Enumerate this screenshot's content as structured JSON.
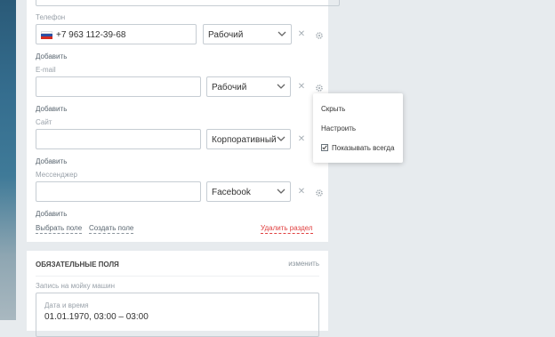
{
  "phone": {
    "label": "Телефон",
    "value": "+7 963 112-39-68",
    "type": "Рабочий",
    "add": "Добавить"
  },
  "email": {
    "label": "E-mail",
    "value": "",
    "type": "Рабочий",
    "add": "Добавить"
  },
  "site": {
    "label": "Сайт",
    "value": "",
    "type": "Корпоративный",
    "add": "Добавить"
  },
  "messenger": {
    "label": "Мессенджер",
    "value": "",
    "type": "Facebook",
    "add": "Добавить"
  },
  "footer_links": {
    "choose_field": "Выбрать поле",
    "create_field": "Создать поле",
    "delete_section": "Удалить раздел"
  },
  "popup": {
    "hide": "Скрыть",
    "configure": "Настроить",
    "show_always": "Показывать всегда",
    "show_always_checked": true
  },
  "required_section": {
    "title": "ОБЯЗАТЕЛЬНЫЕ ПОЛЯ",
    "action": "изменить",
    "field_label": "Запись на мойку машин",
    "date_label": "Дата и время",
    "date_value": "01.01.1970, 03:00 – 03:00"
  },
  "icons": {
    "remove": "close-icon",
    "settings": "gear-icon",
    "dropdown": "chevron-down-icon",
    "flag": "russia-flag-icon"
  },
  "colors": {
    "accent_red": "#e04040",
    "border": "#c6cdd3",
    "label_gray": "#9aa2aa"
  }
}
